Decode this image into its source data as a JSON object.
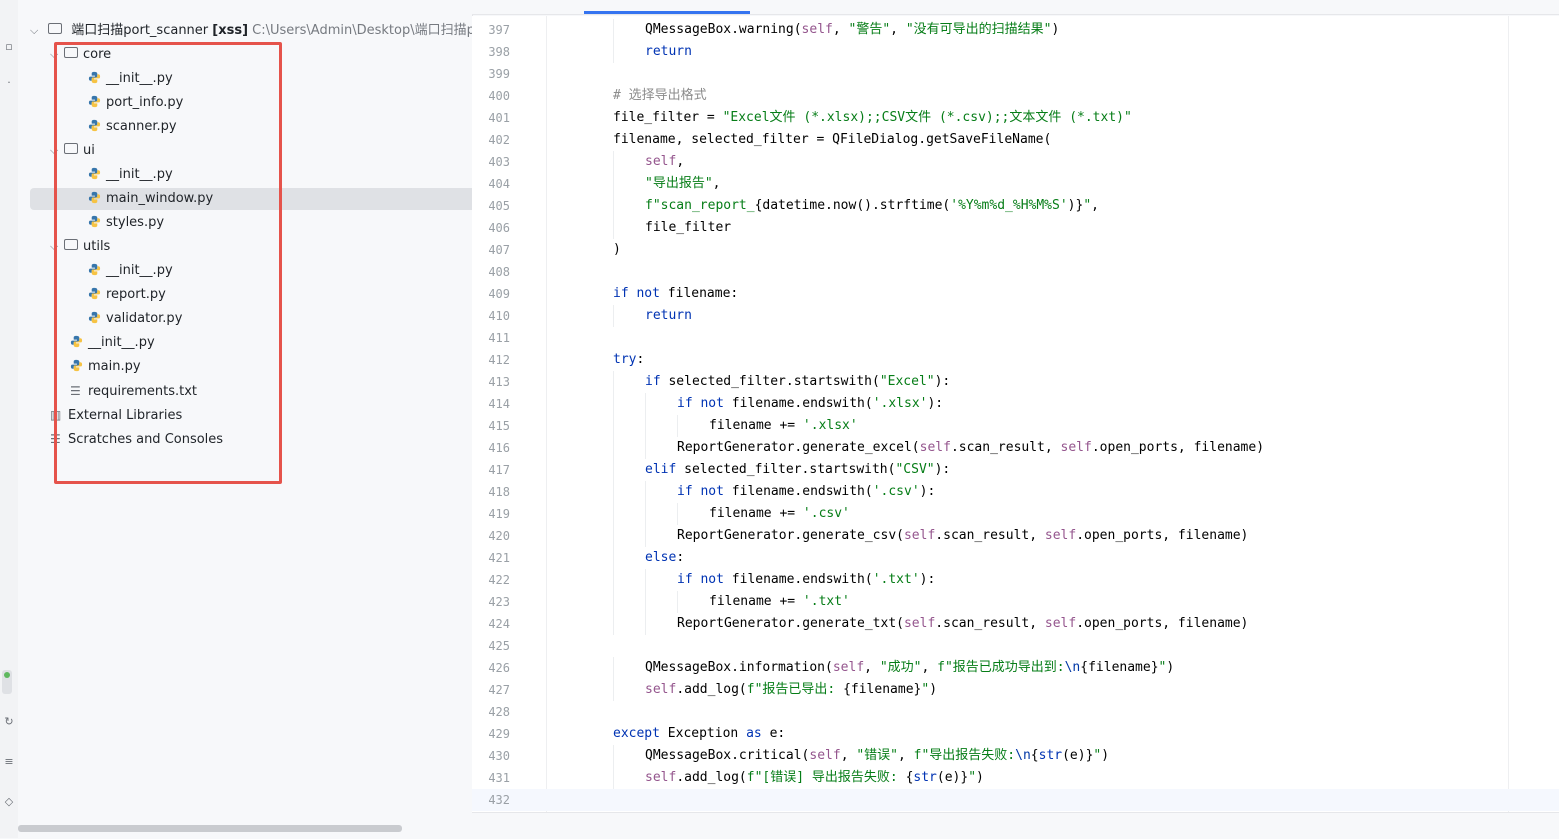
{
  "project": {
    "root_name": "端口扫描port_scanner",
    "root_module": "[xss]",
    "root_path": "C:\\Users\\Admin\\Desktop\\端口扫描po",
    "tree": [
      {
        "label": "core",
        "kind": "folder",
        "depth": 1,
        "expanded": true
      },
      {
        "label": "__init__.py",
        "kind": "py",
        "depth": 2
      },
      {
        "label": "port_info.py",
        "kind": "py",
        "depth": 2
      },
      {
        "label": "scanner.py",
        "kind": "py",
        "depth": 2
      },
      {
        "label": "ui",
        "kind": "folder",
        "depth": 1,
        "expanded": true
      },
      {
        "label": "__init__.py",
        "kind": "py",
        "depth": 2
      },
      {
        "label": "main_window.py",
        "kind": "py",
        "depth": 2,
        "selected": true
      },
      {
        "label": "styles.py",
        "kind": "py",
        "depth": 2
      },
      {
        "label": "utils",
        "kind": "folder",
        "depth": 1,
        "expanded": true
      },
      {
        "label": "__init__.py",
        "kind": "py",
        "depth": 2
      },
      {
        "label": "report.py",
        "kind": "py",
        "depth": 2
      },
      {
        "label": "validator.py",
        "kind": "py",
        "depth": 2
      },
      {
        "label": "__init__.py",
        "kind": "py",
        "depth": 1
      },
      {
        "label": "main.py",
        "kind": "py",
        "depth": 1
      },
      {
        "label": "requirements.txt",
        "kind": "txt",
        "depth": 1
      },
      {
        "label": "External Libraries",
        "kind": "lib",
        "depth": 0
      },
      {
        "label": "Scratches and Consoles",
        "kind": "scratch",
        "depth": 0
      }
    ]
  },
  "editor": {
    "current_line": 432,
    "lines": [
      {
        "n": 397,
        "indent": 2,
        "tokens": [
          [
            "cls",
            "QMessageBox.warning("
          ],
          [
            "slf",
            "self"
          ],
          [
            "cls",
            ", "
          ],
          [
            "str",
            "\"警告\""
          ],
          [
            "cls",
            ", "
          ],
          [
            "str",
            "\"没有可导出的扫描结果\""
          ],
          [
            "cls",
            ")"
          ]
        ]
      },
      {
        "n": 398,
        "indent": 2,
        "tokens": [
          [
            "kw",
            "return"
          ]
        ]
      },
      {
        "n": 399,
        "indent": 0,
        "tokens": []
      },
      {
        "n": 400,
        "indent": 1,
        "tokens": [
          [
            "com",
            "# 选择导出格式"
          ]
        ]
      },
      {
        "n": 401,
        "indent": 1,
        "tokens": [
          [
            "cls",
            "file_filter = "
          ],
          [
            "str",
            "\"Excel文件 (*.xlsx);;CSV文件 (*.csv);;文本文件 (*.txt)\""
          ]
        ]
      },
      {
        "n": 402,
        "indent": 1,
        "tokens": [
          [
            "cls",
            "filename, selected_filter = QFileDialog.getSaveFileName("
          ]
        ]
      },
      {
        "n": 403,
        "indent": 2,
        "tokens": [
          [
            "slf",
            "self"
          ],
          [
            "cls",
            ","
          ]
        ]
      },
      {
        "n": 404,
        "indent": 2,
        "tokens": [
          [
            "str",
            "\"导出报告\""
          ],
          [
            "cls",
            ","
          ]
        ]
      },
      {
        "n": 405,
        "indent": 2,
        "tokens": [
          [
            "str",
            "f\"scan_report_"
          ],
          [
            "cls",
            "{datetime.now().strftime("
          ],
          [
            "str",
            "'%Y%m%d_%H%M%S'"
          ],
          [
            "cls",
            ")}"
          ],
          [
            "str",
            "\""
          ],
          [
            "cls",
            ","
          ]
        ]
      },
      {
        "n": 406,
        "indent": 2,
        "tokens": [
          [
            "cls",
            "file_filter"
          ]
        ]
      },
      {
        "n": 407,
        "indent": 1,
        "tokens": [
          [
            "cls",
            ")"
          ]
        ]
      },
      {
        "n": 408,
        "indent": 0,
        "tokens": []
      },
      {
        "n": 409,
        "indent": 1,
        "tokens": [
          [
            "kw",
            "if not "
          ],
          [
            "cls",
            "filename:"
          ]
        ]
      },
      {
        "n": 410,
        "indent": 2,
        "tokens": [
          [
            "kw",
            "return"
          ]
        ]
      },
      {
        "n": 411,
        "indent": 0,
        "tokens": []
      },
      {
        "n": 412,
        "indent": 1,
        "tokens": [
          [
            "kw",
            "try"
          ],
          [
            "cls",
            ":"
          ]
        ]
      },
      {
        "n": 413,
        "indent": 2,
        "tokens": [
          [
            "kw",
            "if "
          ],
          [
            "cls",
            "selected_filter.startswith("
          ],
          [
            "str",
            "\"Excel\""
          ],
          [
            "cls",
            "):"
          ]
        ]
      },
      {
        "n": 414,
        "indent": 3,
        "tokens": [
          [
            "kw",
            "if not "
          ],
          [
            "cls",
            "filename.endswith("
          ],
          [
            "str",
            "'.xlsx'"
          ],
          [
            "cls",
            "):"
          ]
        ]
      },
      {
        "n": 415,
        "indent": 4,
        "tokens": [
          [
            "cls",
            "filename += "
          ],
          [
            "str",
            "'.xlsx'"
          ]
        ]
      },
      {
        "n": 416,
        "indent": 3,
        "tokens": [
          [
            "cls",
            "ReportGenerator.generate_excel("
          ],
          [
            "slf",
            "self"
          ],
          [
            "cls",
            ".scan_result, "
          ],
          [
            "slf",
            "self"
          ],
          [
            "cls",
            ".open_ports, filename)"
          ]
        ]
      },
      {
        "n": 417,
        "indent": 2,
        "tokens": [
          [
            "kw",
            "elif "
          ],
          [
            "cls",
            "selected_filter.startswith("
          ],
          [
            "str",
            "\"CSV\""
          ],
          [
            "cls",
            "):"
          ]
        ]
      },
      {
        "n": 418,
        "indent": 3,
        "tokens": [
          [
            "kw",
            "if not "
          ],
          [
            "cls",
            "filename.endswith("
          ],
          [
            "str",
            "'.csv'"
          ],
          [
            "cls",
            "):"
          ]
        ]
      },
      {
        "n": 419,
        "indent": 4,
        "tokens": [
          [
            "cls",
            "filename += "
          ],
          [
            "str",
            "'.csv'"
          ]
        ]
      },
      {
        "n": 420,
        "indent": 3,
        "tokens": [
          [
            "cls",
            "ReportGenerator.generate_csv("
          ],
          [
            "slf",
            "self"
          ],
          [
            "cls",
            ".scan_result, "
          ],
          [
            "slf",
            "self"
          ],
          [
            "cls",
            ".open_ports, filename)"
          ]
        ]
      },
      {
        "n": 421,
        "indent": 2,
        "tokens": [
          [
            "kw",
            "else"
          ],
          [
            "cls",
            ":"
          ]
        ]
      },
      {
        "n": 422,
        "indent": 3,
        "tokens": [
          [
            "kw",
            "if not "
          ],
          [
            "cls",
            "filename.endswith("
          ],
          [
            "str",
            "'.txt'"
          ],
          [
            "cls",
            "):"
          ]
        ]
      },
      {
        "n": 423,
        "indent": 4,
        "tokens": [
          [
            "cls",
            "filename += "
          ],
          [
            "str",
            "'.txt'"
          ]
        ]
      },
      {
        "n": 424,
        "indent": 3,
        "tokens": [
          [
            "cls",
            "ReportGenerator.generate_txt("
          ],
          [
            "slf",
            "self"
          ],
          [
            "cls",
            ".scan_result, "
          ],
          [
            "slf",
            "self"
          ],
          [
            "cls",
            ".open_ports, filename)"
          ]
        ]
      },
      {
        "n": 425,
        "indent": 0,
        "tokens": []
      },
      {
        "n": 426,
        "indent": 2,
        "tokens": [
          [
            "cls",
            "QMessageBox.information("
          ],
          [
            "slf",
            "self"
          ],
          [
            "cls",
            ", "
          ],
          [
            "str",
            "\"成功\""
          ],
          [
            "cls",
            ", "
          ],
          [
            "str",
            "f\"报告已成功导出到:"
          ],
          [
            "esc",
            "\\n"
          ],
          [
            "cls",
            "{filename}"
          ],
          [
            "str",
            "\""
          ],
          [
            "cls",
            ")"
          ]
        ]
      },
      {
        "n": 427,
        "indent": 2,
        "tokens": [
          [
            "slf",
            "self"
          ],
          [
            "cls",
            ".add_log("
          ],
          [
            "str",
            "f\"报告已导出: "
          ],
          [
            "cls",
            "{filename}"
          ],
          [
            "str",
            "\""
          ],
          [
            "cls",
            ")"
          ]
        ]
      },
      {
        "n": 428,
        "indent": 0,
        "tokens": []
      },
      {
        "n": 429,
        "indent": 1,
        "tokens": [
          [
            "kw",
            "except "
          ],
          [
            "cls",
            "Exception "
          ],
          [
            "kw",
            "as "
          ],
          [
            "cls",
            "e:"
          ]
        ]
      },
      {
        "n": 430,
        "indent": 2,
        "tokens": [
          [
            "cls",
            "QMessageBox.critical("
          ],
          [
            "slf",
            "self"
          ],
          [
            "cls",
            ", "
          ],
          [
            "str",
            "\"错误\""
          ],
          [
            "cls",
            ", "
          ],
          [
            "str",
            "f\"导出报告失败:"
          ],
          [
            "esc",
            "\\n"
          ],
          [
            "cls",
            "{"
          ],
          [
            "kw",
            "str"
          ],
          [
            "cls",
            "(e)}"
          ],
          [
            "str",
            "\""
          ],
          [
            "cls",
            ")"
          ]
        ]
      },
      {
        "n": 431,
        "indent": 2,
        "tokens": [
          [
            "slf",
            "self"
          ],
          [
            "cls",
            ".add_log("
          ],
          [
            "str",
            "f\"[错误] 导出报告失败: "
          ],
          [
            "cls",
            "{"
          ],
          [
            "kw",
            "str"
          ],
          [
            "cls",
            "(e)}"
          ],
          [
            "str",
            "\""
          ],
          [
            "cls",
            ")"
          ]
        ]
      },
      {
        "n": 432,
        "indent": 0,
        "tokens": []
      }
    ]
  },
  "colors": {
    "highlight_box": "#e5534b",
    "keyword": "#0033b3",
    "string": "#067d17",
    "comment": "#8c8c8c",
    "self": "#94558d",
    "tab_accent": "#3574f0"
  },
  "icons": [
    "chevron-down-icon",
    "folder-icon",
    "python-file-icon",
    "text-file-icon",
    "library-icon",
    "scratch-icon"
  ]
}
